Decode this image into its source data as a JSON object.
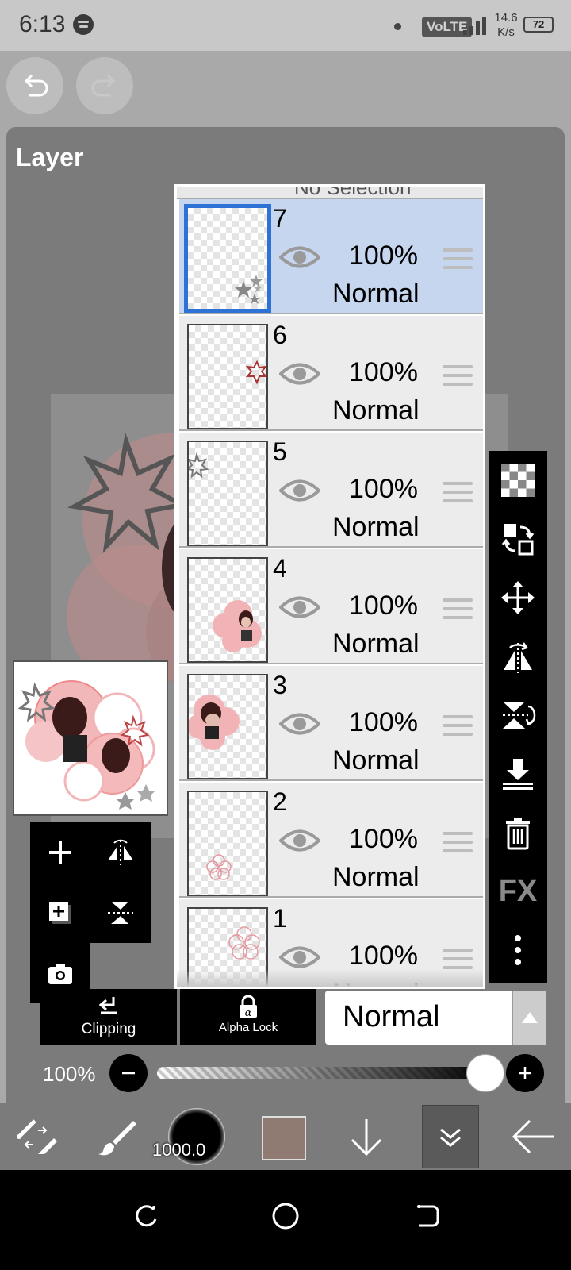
{
  "status": {
    "time": "6:13",
    "volte": "VoLTE",
    "net_speed_value": "14.6",
    "net_speed_unit": "K/s",
    "battery": "72"
  },
  "panel": {
    "title": "Layer"
  },
  "layer_list": {
    "clipped_label": "No Selection",
    "layers": [
      {
        "number": "7",
        "opacity": "100%",
        "mode": "Normal",
        "selected": true
      },
      {
        "number": "6",
        "opacity": "100%",
        "mode": "Normal",
        "selected": false
      },
      {
        "number": "5",
        "opacity": "100%",
        "mode": "Normal",
        "selected": false
      },
      {
        "number": "4",
        "opacity": "100%",
        "mode": "Normal",
        "selected": false
      },
      {
        "number": "3",
        "opacity": "100%",
        "mode": "Normal",
        "selected": false
      },
      {
        "number": "2",
        "opacity": "100%",
        "mode": "Normal",
        "selected": false
      },
      {
        "number": "1",
        "opacity": "100%",
        "mode": "Normal",
        "selected": false
      }
    ]
  },
  "right_toolbar": {
    "fx_label": "FX"
  },
  "bottom_controls": {
    "clipping_label": "Clipping",
    "alpha_lock_label": "Alpha Lock",
    "blend_mode": "Normal",
    "opacity_label": "100%",
    "opacity_value": 1.0
  },
  "bottom_toolbar": {
    "brush_size": "1000.0",
    "color_swatch": "#8f7b72"
  },
  "icons": {
    "status": [
      "spotify-icon",
      "dot-icon",
      "signal-icon",
      "battery-icon"
    ],
    "history": [
      "undo-icon",
      "redo-icon"
    ],
    "layer_row": [
      "visibility-eye-icon",
      "drag-handle-icon"
    ],
    "right_toolbar": [
      "transparency-checker-icon",
      "reference-swap-icon",
      "move-icon",
      "flip-horizontal-icon",
      "flip-vertical-icon",
      "merge-down-icon",
      "trash-icon",
      "fx-icon",
      "more-vertical-icon"
    ],
    "left_tools": [
      "add-layer-icon",
      "flip-layer-icon",
      "add-copy-icon",
      "flip-vertical-layer-icon",
      "camera-icon"
    ],
    "bottom_toolbar": [
      "transform-tool-icon",
      "brush-tool-icon",
      "arrow-down-icon",
      "layers-collapse-icon",
      "back-arrow-icon"
    ],
    "nav": [
      "recent-apps-icon",
      "home-icon",
      "back-icon"
    ]
  },
  "colors": {
    "selected_layer": "#c6d6ef",
    "selected_border": "#2f72d6",
    "panel_bg": "#7b7b7b"
  }
}
